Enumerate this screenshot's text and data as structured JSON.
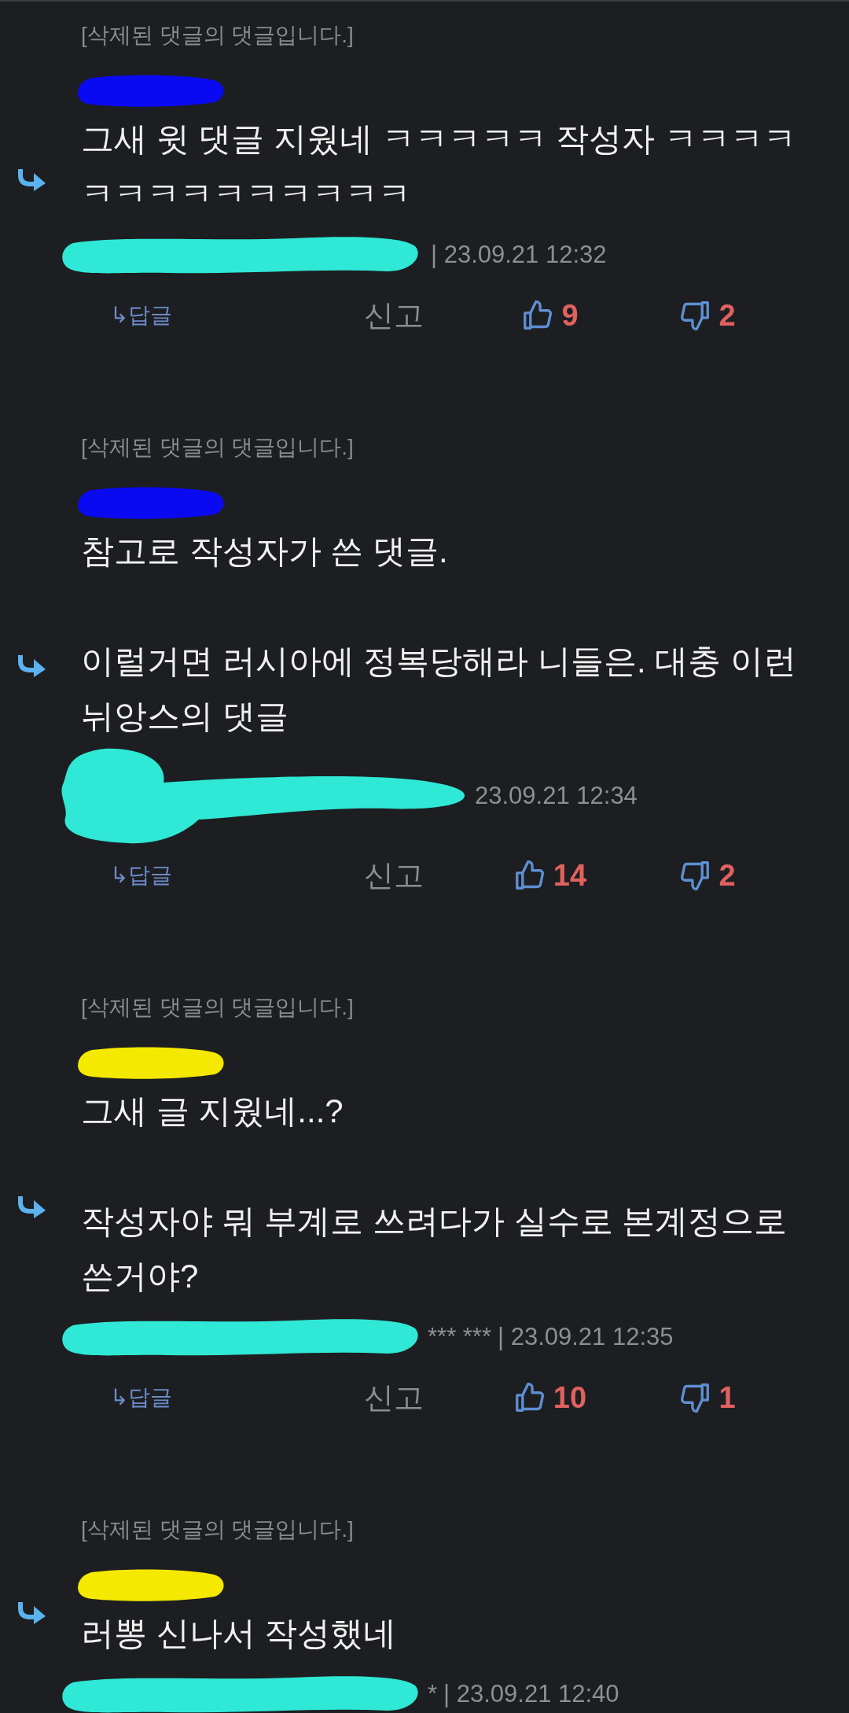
{
  "comments": [
    {
      "notice": "[삭제된 댓글의 댓글입니다.]",
      "author_mark": {
        "color": "#0a0af2"
      },
      "paragraphs": [
        "그새 윗 댓글 지웠네 ㅋㅋㅋㅋㅋ 작성자 ㅋㅋㅋㅋㅋㅋㅋㅋㅋㅋㅋㅋㅋㅋ"
      ],
      "meta": {
        "mark": {
          "kind": "flat"
        },
        "date": "| 23.09.21 12:32"
      },
      "actions": {
        "reply": "↳답글",
        "report": "신고",
        "likes": "9",
        "dislikes": "2"
      }
    },
    {
      "notice": "[삭제된 댓글의 댓글입니다.]",
      "author_mark": {
        "color": "#0a0af2"
      },
      "paragraphs": [
        "참고로 작성자가 쓴 댓글.",
        "이럴거면 러시아에 정복당해라 니들은. 대충 이런 뉘앙스의 댓글"
      ],
      "meta": {
        "mark": {
          "kind": "tall"
        },
        "date": "23.09.21 12:34"
      },
      "actions": {
        "reply": "↳답글",
        "report": "신고",
        "likes": "14",
        "dislikes": "2"
      }
    },
    {
      "notice": "[삭제된 댓글의 댓글입니다.]",
      "author_mark": {
        "color": "#f5e900"
      },
      "paragraphs": [
        "그새 글 지웠네...?",
        "작성자야 뭐 부계로 쓰려다가 실수로 본계정으로 쓴거야?"
      ],
      "meta": {
        "mark": {
          "kind": "flat"
        },
        "visible_author": "*** ***",
        "date": "| 23.09.21 12:35"
      },
      "actions": {
        "reply": "↳답글",
        "report": "신고",
        "likes": "10",
        "dislikes": "1"
      }
    },
    {
      "notice": "[삭제된 댓글의 댓글입니다.]",
      "author_mark": {
        "color": "#f5e900"
      },
      "paragraphs": [
        "러뽕 신나서 작성했네"
      ],
      "meta": {
        "mark": {
          "kind": "flat"
        },
        "visible_author": "*",
        "date": "| 23.09.21 12:40"
      }
    }
  ]
}
